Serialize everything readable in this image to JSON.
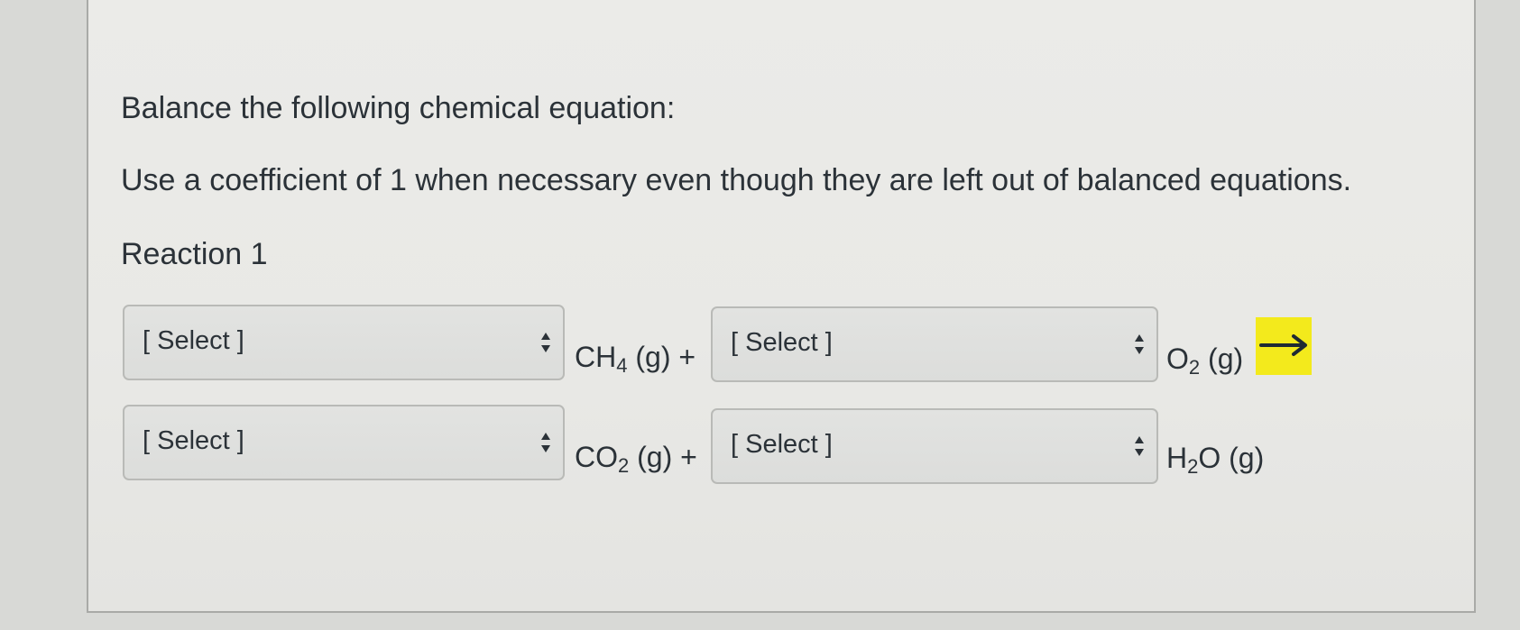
{
  "question": {
    "instruction": "Balance the following chemical equation:",
    "note": "Use a coefficient of 1 when necessary even though they are left out of balanced equations.",
    "reaction_label": "Reaction 1"
  },
  "equation": {
    "reactants": [
      {
        "coefficient_select": {
          "selected": "[ Select ]"
        },
        "formula": "CH",
        "subscript": "4",
        "state": "(g)",
        "joiner": "+"
      },
      {
        "coefficient_select": {
          "selected": "[ Select ]"
        },
        "formula": "O",
        "subscript": "2",
        "state": "(g)",
        "joiner": ""
      }
    ],
    "products": [
      {
        "coefficient_select": {
          "selected": "[ Select ]"
        },
        "formula": "CO",
        "subscript": "2",
        "state": "(g)",
        "joiner": "+"
      },
      {
        "coefficient_select": {
          "selected": "[ Select ]"
        },
        "formula": "H",
        "subscript": "2",
        "formula_suffix": "O",
        "state": "(g)",
        "joiner": ""
      }
    ],
    "arrow_icon": "right-arrow-icon",
    "arrow_highlight_color": "#f3ea1c"
  }
}
